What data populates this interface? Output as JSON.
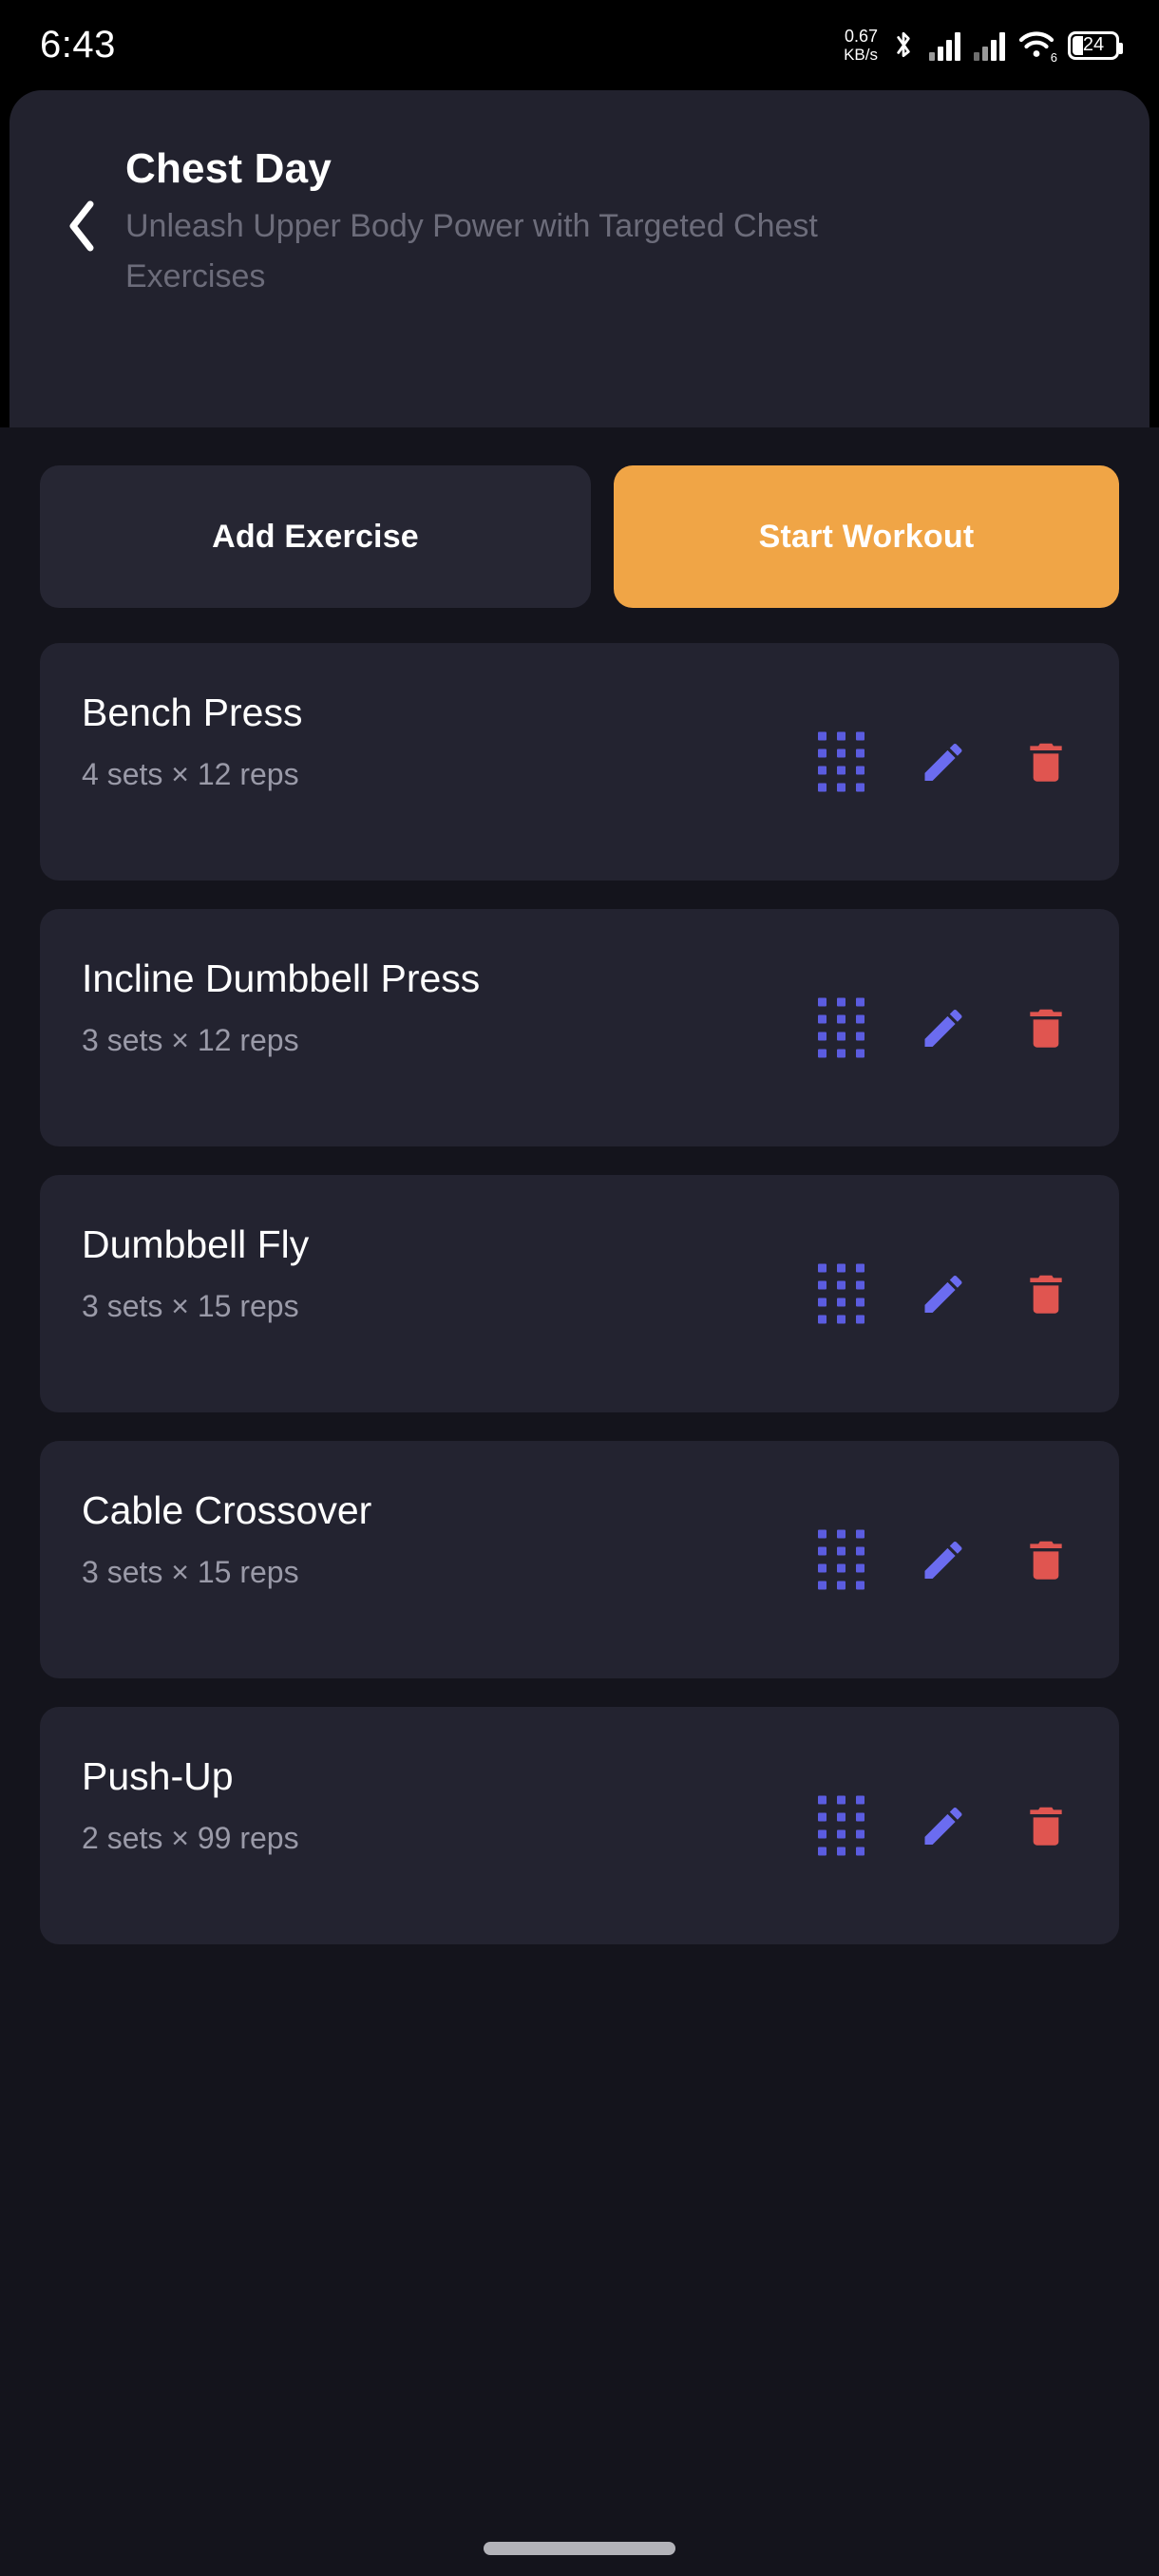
{
  "statusbar": {
    "time": "6:43",
    "net_speed_value": "0.67",
    "net_speed_unit": "KB/s",
    "wifi_generation": "6",
    "battery_level": "24",
    "icons": [
      "bluetooth-icon",
      "signal-icon",
      "signal-icon",
      "wifi-icon",
      "battery-icon"
    ]
  },
  "header": {
    "back_label": "‹",
    "title": "Chest Day",
    "subtitle": "Unleash Upper Body Power with Targeted Chest Exercises"
  },
  "actions": {
    "add_exercise_label": "Add Exercise",
    "start_workout_label": "Start Workout"
  },
  "exercises": [
    {
      "name": "Bench Press",
      "detail": "4 sets × 12 reps"
    },
    {
      "name": "Incline Dumbbell Press",
      "detail": "3 sets × 12 reps"
    },
    {
      "name": "Dumbbell Fly",
      "detail": "3 sets × 15 reps"
    },
    {
      "name": "Cable Crossover",
      "detail": "3 sets × 15 reps"
    },
    {
      "name": "Push-Up",
      "detail": "2 sets × 99 reps"
    }
  ],
  "row_icons": {
    "drag_handle": "drag-handle-icon",
    "edit": "pencil-icon",
    "delete": "trash-icon"
  },
  "colors": {
    "page_background": "#14141c",
    "header_background": "#22222e",
    "card_background": "#232330",
    "accent_orange": "#f0a546",
    "icon_indigo": "#5b5ce0",
    "icon_pencil": "#6b6cf0",
    "icon_red": "#e05550",
    "text_primary": "#ffffff",
    "text_muted": "#9a9aa8",
    "subtitle_muted": "#6c6c7a"
  }
}
